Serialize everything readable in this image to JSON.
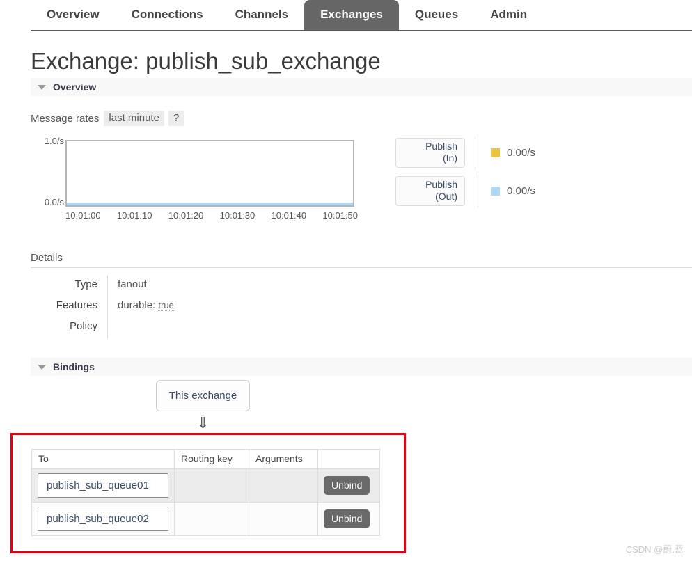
{
  "nav": {
    "tabs": [
      {
        "label": "Overview",
        "active": false
      },
      {
        "label": "Connections",
        "active": false
      },
      {
        "label": "Channels",
        "active": false
      },
      {
        "label": "Exchanges",
        "active": true
      },
      {
        "label": "Queues",
        "active": false
      },
      {
        "label": "Admin",
        "active": false
      }
    ]
  },
  "page": {
    "title": "Exchange: publish_sub_exchange"
  },
  "overview_section": {
    "header": "Overview",
    "message_rates_label": "Message rates",
    "period_chip": "last minute",
    "help_chip": "?"
  },
  "chart_data": {
    "type": "line",
    "title": "Message rates",
    "xlabel": "",
    "ylabel": "",
    "x": [
      "10:01:00",
      "10:01:10",
      "10:01:20",
      "10:01:30",
      "10:01:40",
      "10:01:50"
    ],
    "ytick_labels": [
      "1.0/s",
      "0.0/s"
    ],
    "ylim": [
      0,
      1
    ],
    "grid": false,
    "legend_position": "right",
    "series": [
      {
        "name": "Publish (In)",
        "color": "#edc240",
        "current_value": "0.00/s",
        "values": [
          0,
          0,
          0,
          0,
          0,
          0
        ]
      },
      {
        "name": "Publish (Out)",
        "color": "#afd8f8",
        "current_value": "0.00/s",
        "values": [
          0,
          0,
          0,
          0,
          0,
          0
        ]
      }
    ]
  },
  "legend": {
    "items": [
      {
        "box_line1": "Publish",
        "box_line2": "(In)",
        "value": "0.00/s"
      },
      {
        "box_line1": "Publish",
        "box_line2": "(Out)",
        "value": "0.00/s"
      }
    ]
  },
  "details": {
    "label": "Details",
    "rows": [
      {
        "key": "Type",
        "value": "fanout",
        "value_suffix": ""
      },
      {
        "key": "Features",
        "value": "durable:",
        "value_suffix": "true"
      },
      {
        "key": "Policy",
        "value": "",
        "value_suffix": ""
      }
    ]
  },
  "bindings_section": {
    "header": "Bindings",
    "this_exchange_label": "This exchange",
    "arrow_glyph": "⇓",
    "table": {
      "columns": [
        "To",
        "Routing key",
        "Arguments",
        ""
      ],
      "rows": [
        {
          "to": "publish_sub_queue01",
          "routing_key": "",
          "arguments": "",
          "action": "Unbind"
        },
        {
          "to": "publish_sub_queue02",
          "routing_key": "",
          "arguments": "",
          "action": "Unbind"
        }
      ]
    }
  },
  "annotation": {
    "color": "#e60012"
  },
  "watermark": {
    "text": "CSDN @蔚.蓝"
  }
}
